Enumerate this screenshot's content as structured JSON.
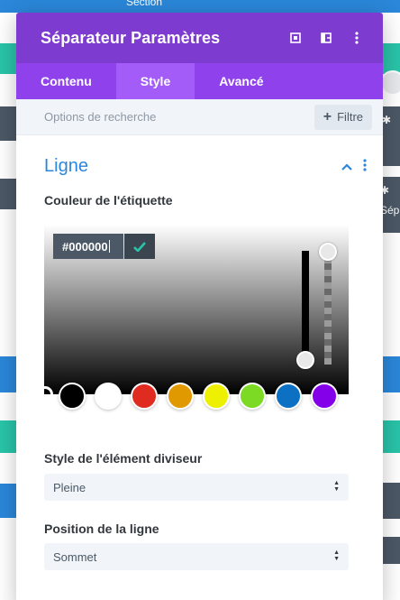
{
  "background": {
    "section_label": "Section",
    "right_module_label": "Sép"
  },
  "modal": {
    "title": "Séparateur Paramètres",
    "header_icons": [
      "expand-icon",
      "columns-icon",
      "more-vertical-icon"
    ],
    "tabs": [
      {
        "label": "Contenu",
        "active": false
      },
      {
        "label": "Style",
        "active": true
      },
      {
        "label": "Avancé",
        "active": false
      }
    ],
    "search": {
      "placeholder": "Options de recherche",
      "filter_label": "Filtre"
    }
  },
  "group": {
    "title": "Ligne",
    "color_option": {
      "label": "Couleur de l'étiquette",
      "hex_value": "#000000",
      "swatches": [
        "#000000",
        "#ffffff",
        "#e02b20",
        "#e09900",
        "#edf000",
        "#7cda24",
        "#0c71c3",
        "#8300e9"
      ]
    },
    "divider_style": {
      "label": "Style de l'élément diviseur",
      "value": "Pleine"
    },
    "line_position": {
      "label": "Position de la ligne",
      "value": "Sommet"
    }
  },
  "colors": {
    "header": "#7e3bd0",
    "tabs": "#8f42ec",
    "tab_active": "#a35cf7",
    "accent": "#2b87da"
  }
}
